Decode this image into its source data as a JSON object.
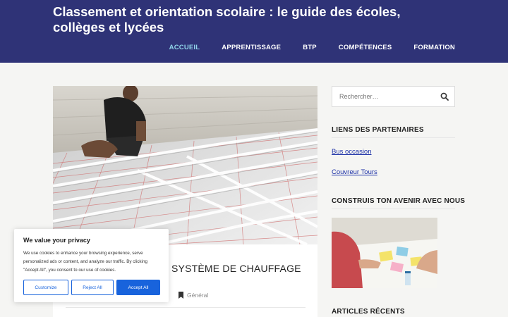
{
  "site": {
    "title": "Classement et orientation scolaire : le guide des écoles, collèges et lycées"
  },
  "nav": {
    "items": [
      {
        "label": "ACCUEIL",
        "active": true
      },
      {
        "label": "APPRENTISSAGE"
      },
      {
        "label": "BTP"
      },
      {
        "label": "COMPÉTENCES"
      },
      {
        "label": "FORMATION"
      }
    ]
  },
  "post": {
    "title": "SYSTÈME DE CHAUFFAGE",
    "category": "Général"
  },
  "search": {
    "placeholder": "Rechercher…"
  },
  "sidebar": {
    "partners_title": "LIENS DES PARTENAIRES",
    "partner_links": [
      "Bus occasion",
      "Couvreur Tours"
    ],
    "avenir_title": "CONSTRUIS TON AVENIR AVEC NOUS",
    "recent_title": "ARTICLES RÉCENTS"
  },
  "cookie": {
    "title": "We value your privacy",
    "text": "We use cookies to enhance your browsing experience, serve personalized ads or content, and analyze our traffic. By clicking \"Accept All\", you consent to our use of cookies.",
    "customize_label": "Customize",
    "reject_label": "Reject All",
    "accept_label": "Accept All"
  },
  "colors": {
    "header_bg": "#2f3377",
    "nav_active": "#8fd3e8",
    "link": "#1a2fa6",
    "cookie_accent": "#1863dc"
  }
}
